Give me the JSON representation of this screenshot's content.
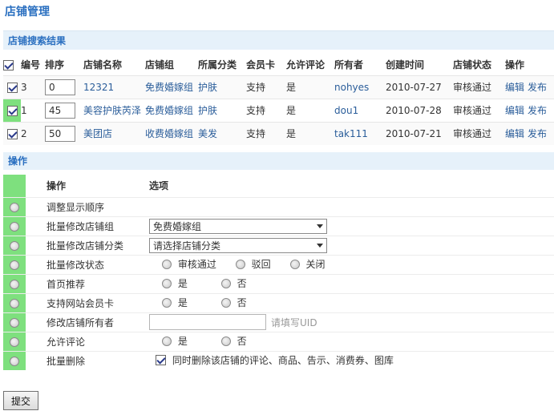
{
  "page_title": "店铺管理",
  "results": {
    "header": "店铺搜索结果",
    "columns": [
      "编号",
      "排序",
      "店铺名称",
      "店铺组",
      "所属分类",
      "会员卡",
      "允许评论",
      "所有者",
      "创建时间",
      "店铺状态",
      "操作"
    ],
    "rows": [
      {
        "id": "3",
        "sort": "0",
        "name": "12321",
        "group": "免费婚嫁组",
        "category": "护肤",
        "member_card": "支持",
        "allow_comment": "是",
        "owner": "nohyes",
        "created": "2010-07-27",
        "status": "审核通过",
        "edit": "编辑",
        "publish": "发布"
      },
      {
        "id": "1",
        "sort": "45",
        "name": "美容护肤芮泽",
        "group": "免费婚嫁组",
        "category": "护肤",
        "member_card": "支持",
        "allow_comment": "是",
        "owner": "dou1",
        "created": "2010-07-28",
        "status": "审核通过",
        "edit": "编辑",
        "publish": "发布"
      },
      {
        "id": "2",
        "sort": "50",
        "name": "美团店",
        "group": "收费婚嫁组",
        "category": "美发",
        "member_card": "支持",
        "allow_comment": "是",
        "owner": "tak111",
        "created": "2010-07-21",
        "status": "审核通过",
        "edit": "编辑",
        "publish": "发布"
      }
    ]
  },
  "operations": {
    "header": "操作",
    "col_op": "操作",
    "col_options": "选项",
    "adjust_order": "调整显示顺序",
    "batch_group": {
      "label": "批量修改店铺组",
      "selected": "免费婚嫁组"
    },
    "batch_category": {
      "label": "批量修改店铺分类",
      "selected": "请选择店铺分类"
    },
    "batch_status": {
      "label": "批量修改状态",
      "options": [
        "审核通过",
        "驳回",
        "关闭"
      ]
    },
    "homepage_recommend": {
      "label": "首页推荐",
      "options": [
        "是",
        "否"
      ]
    },
    "member_card": {
      "label": "支持网站会员卡",
      "options": [
        "是",
        "否"
      ]
    },
    "change_owner": {
      "label": "修改店铺所有者",
      "value": "",
      "hint": "请填写UID"
    },
    "allow_comment": {
      "label": "允许评论",
      "options": [
        "是",
        "否"
      ]
    },
    "batch_delete": {
      "label": "批量删除",
      "checkbox_label": "同时删除该店铺的评论、商品、告示、消费券、图库"
    }
  },
  "submit_label": "提交",
  "colors": {
    "accent": "#2a6fc0",
    "section_bg": "#e6f1fa",
    "highlight": "#7ee07e",
    "link": "#2a5d9a"
  }
}
